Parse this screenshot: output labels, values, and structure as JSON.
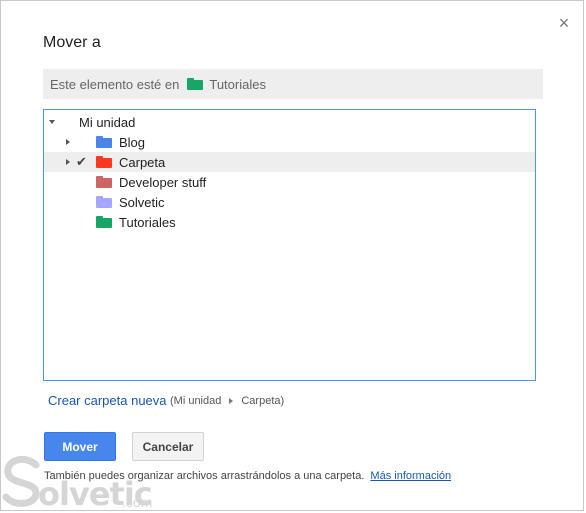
{
  "dialog": {
    "title": "Mover a",
    "close_glyph": "×"
  },
  "location": {
    "prefix": "Este elemento esté en",
    "folder_name": "Tutoriales",
    "folder_color": "#16a765"
  },
  "tree": {
    "root_label": "Mi unidad",
    "items": [
      {
        "label": "Blog",
        "color": "#4986e7",
        "expandable": true,
        "selected": false
      },
      {
        "label": "Carpeta",
        "color": "#f83a22",
        "expandable": true,
        "selected": true
      },
      {
        "label": "Developer stuff",
        "color": "#cc6666",
        "expandable": false,
        "selected": false
      },
      {
        "label": "Solvetic",
        "color": "#a4a6ff",
        "expandable": false,
        "selected": false
      },
      {
        "label": "Tutoriales",
        "color": "#16a765",
        "expandable": false,
        "selected": false
      }
    ],
    "check_glyph": "✔"
  },
  "new_folder": {
    "link_label": "Crear carpeta nueva",
    "crumb_open": "(Mi unidad",
    "crumb_close": "Carpeta)"
  },
  "buttons": {
    "move_label": "Mover",
    "cancel_label": "Cancelar"
  },
  "hint": {
    "text": "También puedes organizar archivos arrastrándolos a una carpeta.",
    "link_label": "Más información"
  },
  "watermark": {
    "brand": "olvetic",
    "suffix": ".com"
  },
  "colors": {
    "accent": "#4787ed",
    "link": "#1a55b5",
    "tree_border": "#4d90fe"
  }
}
